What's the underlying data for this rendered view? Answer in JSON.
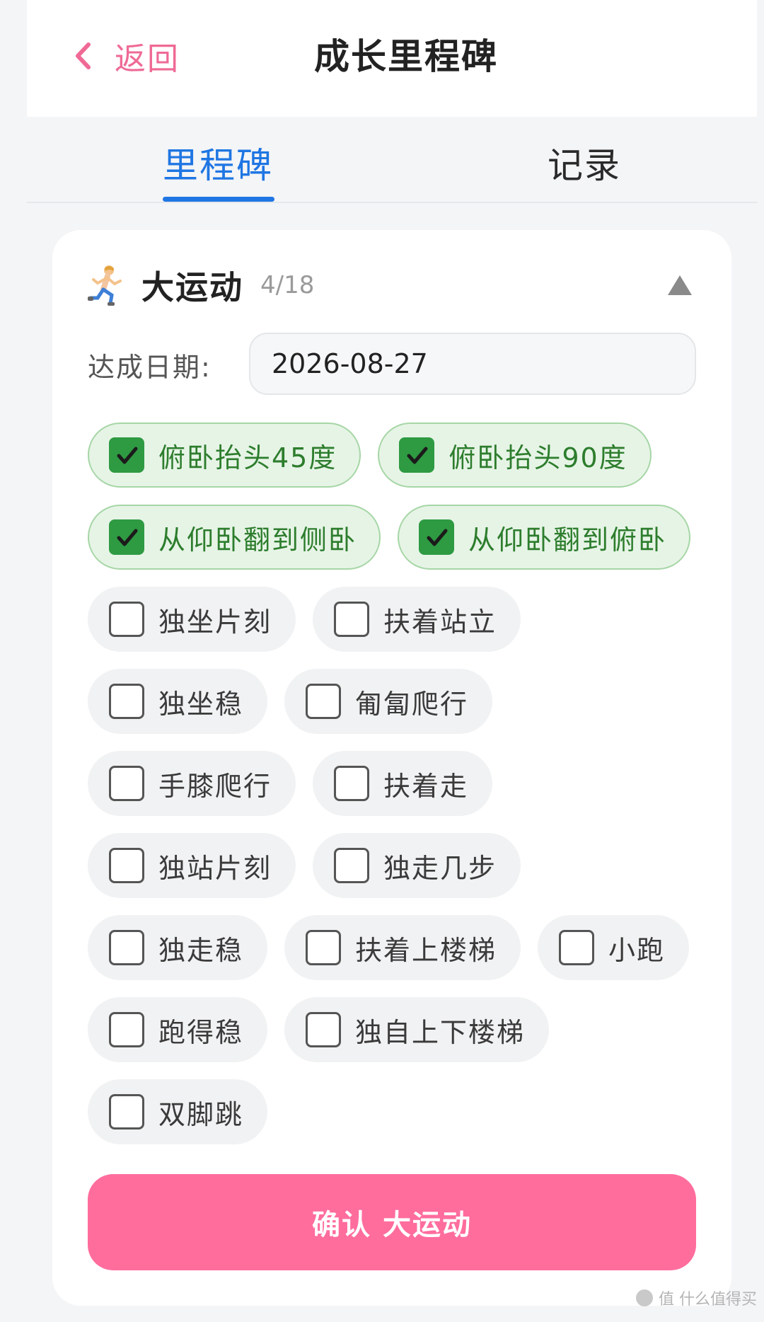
{
  "header": {
    "back_label": "返回",
    "title": "成长里程碑"
  },
  "tabs": [
    {
      "label": "里程碑",
      "active": true
    },
    {
      "label": "记录",
      "active": false
    }
  ],
  "category": {
    "icon": "runner-emoji",
    "title": "大运动",
    "count": "4/18",
    "collapse_icon": "triangle-up-icon"
  },
  "date": {
    "label": "达成日期:",
    "value": "2026-08-27"
  },
  "milestone_rows": [
    [
      {
        "label": "俯卧抬头45度",
        "checked": true
      },
      {
        "label": "俯卧抬头90度",
        "checked": true
      }
    ],
    [
      {
        "label": "从仰卧翻到侧卧",
        "checked": true
      },
      {
        "label": "从仰卧翻到俯卧",
        "checked": true
      }
    ],
    [
      {
        "label": "独坐片刻",
        "checked": false
      },
      {
        "label": "扶着站立",
        "checked": false
      }
    ],
    [
      {
        "label": "独坐稳",
        "checked": false
      },
      {
        "label": "匍匐爬行",
        "checked": false
      }
    ],
    [
      {
        "label": "手膝爬行",
        "checked": false
      },
      {
        "label": "扶着走",
        "checked": false
      }
    ],
    [
      {
        "label": "独站片刻",
        "checked": false
      },
      {
        "label": "独走几步",
        "checked": false
      }
    ],
    [
      {
        "label": "独走稳",
        "checked": false
      },
      {
        "label": "扶着上楼梯",
        "checked": false
      },
      {
        "label": "小跑",
        "checked": false
      }
    ],
    [
      {
        "label": "跑得稳",
        "checked": false
      },
      {
        "label": "独自上下楼梯",
        "checked": false
      }
    ],
    [
      {
        "label": "双脚跳",
        "checked": false
      }
    ]
  ],
  "confirm_button": "确认 大运动",
  "watermark": "值 什么值得买",
  "colors": {
    "accent_pink": "#ff6d9d",
    "tab_blue": "#1f76e3",
    "check_green": "#2e9a42"
  }
}
